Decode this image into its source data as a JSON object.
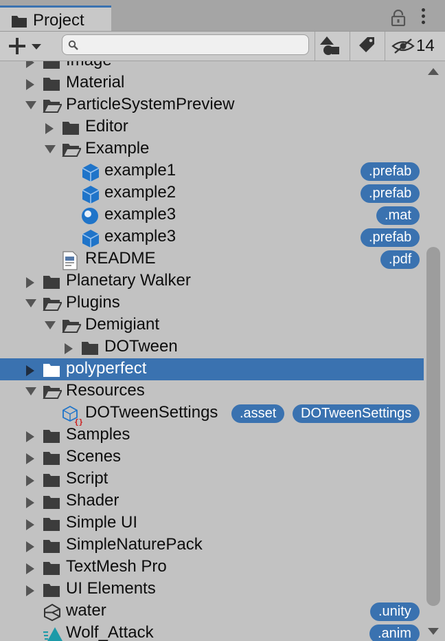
{
  "tab": {
    "label": "Project",
    "icon": "folder-icon"
  },
  "toolbar": {
    "add_icon": "plus-icon",
    "search": {
      "value": "",
      "placeholder": ""
    },
    "hidden_count": "14"
  },
  "tree": [
    {
      "label": "Image",
      "type": "folder",
      "indent": 0,
      "arrow": "collapsed"
    },
    {
      "label": "Material",
      "type": "folder",
      "indent": 0,
      "arrow": "collapsed"
    },
    {
      "label": "ParticleSystemPreview",
      "type": "folder-open",
      "indent": 0,
      "arrow": "expanded"
    },
    {
      "label": "Editor",
      "type": "folder",
      "indent": 1,
      "arrow": "collapsed"
    },
    {
      "label": "Example",
      "type": "folder-open",
      "indent": 1,
      "arrow": "expanded"
    },
    {
      "label": "example1",
      "type": "prefab",
      "indent": 2,
      "arrow": "none",
      "badges": [
        ".prefab"
      ]
    },
    {
      "label": "example2",
      "type": "prefab",
      "indent": 2,
      "arrow": "none",
      "badges": [
        ".prefab"
      ]
    },
    {
      "label": "example3",
      "type": "material",
      "indent": 2,
      "arrow": "none",
      "badges": [
        ".mat"
      ]
    },
    {
      "label": "example3",
      "type": "prefab",
      "indent": 2,
      "arrow": "none",
      "badges": [
        ".prefab"
      ]
    },
    {
      "label": "README",
      "type": "pdf",
      "indent": 1,
      "arrow": "none",
      "badges": [
        ".pdf"
      ]
    },
    {
      "label": "Planetary Walker",
      "type": "folder",
      "indent": 0,
      "arrow": "collapsed"
    },
    {
      "label": "Plugins",
      "type": "folder-open",
      "indent": 0,
      "arrow": "expanded"
    },
    {
      "label": "Demigiant",
      "type": "folder-open",
      "indent": 1,
      "arrow": "expanded"
    },
    {
      "label": "DOTween",
      "type": "folder",
      "indent": 2,
      "arrow": "collapsed"
    },
    {
      "label": "polyperfect",
      "type": "folder",
      "indent": 0,
      "arrow": "collapsed",
      "selected": true
    },
    {
      "label": "Resources",
      "type": "folder-open",
      "indent": 0,
      "arrow": "expanded"
    },
    {
      "label": "DOTweenSettings",
      "type": "asset",
      "indent": 1,
      "arrow": "none",
      "badges": [
        "DOTweenSettings",
        ".asset"
      ]
    },
    {
      "label": "Samples",
      "type": "folder",
      "indent": 0,
      "arrow": "collapsed"
    },
    {
      "label": "Scenes",
      "type": "folder",
      "indent": 0,
      "arrow": "collapsed"
    },
    {
      "label": "Script",
      "type": "folder",
      "indent": 0,
      "arrow": "collapsed"
    },
    {
      "label": "Shader",
      "type": "folder",
      "indent": 0,
      "arrow": "collapsed"
    },
    {
      "label": "Simple UI",
      "type": "folder",
      "indent": 0,
      "arrow": "collapsed"
    },
    {
      "label": "SimpleNaturePack",
      "type": "folder",
      "indent": 0,
      "arrow": "collapsed"
    },
    {
      "label": "TextMesh Pro",
      "type": "folder",
      "indent": 0,
      "arrow": "collapsed"
    },
    {
      "label": "UI Elements",
      "type": "folder",
      "indent": 0,
      "arrow": "collapsed"
    },
    {
      "label": "water",
      "type": "unity",
      "indent": 0,
      "arrow": "none",
      "badges": [
        ".unity"
      ]
    },
    {
      "label": "Wolf_Attack",
      "type": "anim",
      "indent": 0,
      "arrow": "none",
      "badges": [
        ".anim"
      ]
    }
  ],
  "colors": {
    "accent": "#3a72b0",
    "panel": "#c2c2c2",
    "tabbar": "#a5a5a5",
    "folder": "#3c3c3c",
    "prefab": "#1f74c9"
  }
}
